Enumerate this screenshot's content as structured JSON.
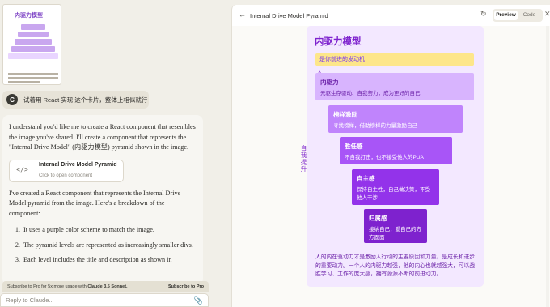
{
  "chat": {
    "thumbnail": {
      "title": "内驱力模型"
    },
    "user_message": {
      "avatar": "C",
      "text": "试着用 React 实现 这个卡片，整体上相似就行"
    },
    "assistant": {
      "p1": "I understand you'd like me to create a React component that resembles the image you've shared. I'll create a component that represents the \"Internal Drive Model\" (内驱力模型) pyramid shown in the image.",
      "artifact_title": "Internal Drive Model Pyramid",
      "artifact_sub": "Click to open component",
      "artifact_icon": "code-icon",
      "p2": "I've created a React component that represents the Internal Drive Model pyramid from the image. Here's a breakdown of the component:",
      "list": [
        "It uses a purple color scheme to match the image.",
        "The pyramid levels are represented as increasingly smaller divs.",
        "Each level includes the title and description as shown in"
      ]
    },
    "promo": {
      "text": "Subscribe to Pro for 5x more usage with",
      "model": "Claude 3.5 Sonnet.",
      "link": "Subscribe to Pro"
    },
    "reply_placeholder": "Reply to Claude..."
  },
  "panel": {
    "title": "Internal Drive Model Pyramid",
    "tabs": [
      "Preview",
      "Code"
    ],
    "active_tab": "Preview"
  },
  "card": {
    "title": "内驱力模型",
    "banner": "是你前进的发动机",
    "side_label": "自我提升",
    "levels": [
      {
        "name": "内驱力",
        "desc": "元驱生存驱动、自我努力，成为更好的自己"
      },
      {
        "name": "榜样激励",
        "desc": "寻找榜样，借助榜样的力量激励自己"
      },
      {
        "name": "胜任感",
        "desc": "不自我打击，也不接受他人的PUA"
      },
      {
        "name": "自主感",
        "desc": "保持自主性，自己做决策，不受他人干涉"
      },
      {
        "name": "归属感",
        "desc": "接纳自己，爱自己的方方面面"
      }
    ],
    "footer": "人的内在驱动力才是激励人行动的主要原因和力量，是成长和进步的重要动力。一个人的内驱力越强，他的内心也就越强大，可以战胜学习、工作的庞大感，拥有源源不断的前进动力。"
  },
  "colors": {
    "accent_purple": "#7e22ce",
    "banner_yellow": "#fde68a",
    "card_bg": "#f3e8ff"
  }
}
